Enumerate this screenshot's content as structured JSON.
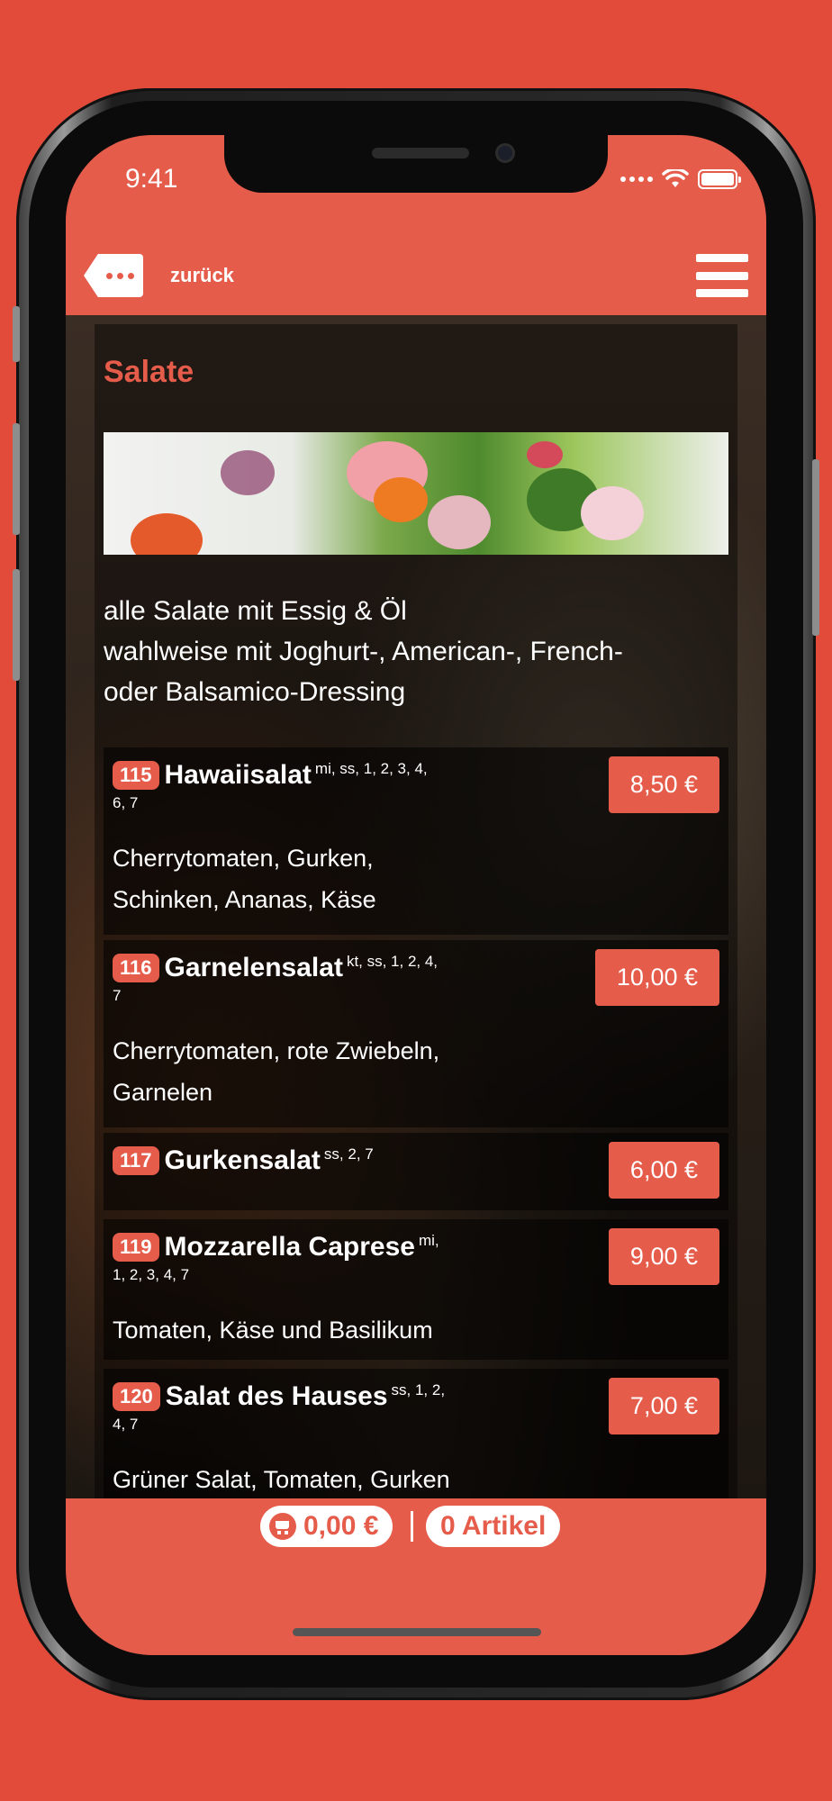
{
  "status": {
    "time": "9:41"
  },
  "header": {
    "back_label": "zurück"
  },
  "category": {
    "title": "Salate",
    "intro_line1": "alle Salate mit Essig & Öl",
    "intro_line2": "wahlweise mit Joghurt-, American-, French-",
    "intro_line3": "oder Balsamico-Dressing"
  },
  "items": [
    {
      "number": "115",
      "name": "Hawaiisalat",
      "allergens": "mi, ss, 1, 2, 3, 4,",
      "allergens_cont": "6, 7",
      "desc_line1": "Cherrytomaten, Gurken,",
      "desc_line2": "Schinken, Ananas, Käse",
      "price": "8,50 €"
    },
    {
      "number": "116",
      "name": "Garnelensalat",
      "allergens": "kt, ss, 1, 2, 4,",
      "allergens_cont": "7",
      "desc_line1": "Cherrytomaten, rote Zwiebeln,",
      "desc_line2": "Garnelen",
      "price": "10,00 €"
    },
    {
      "number": "117",
      "name": "Gurkensalat",
      "allergens": "ss, 2, 7",
      "price": "6,00 €"
    },
    {
      "number": "119",
      "name": "Mozzarella Caprese",
      "allergens": "mi,",
      "allergens_cont": "1, 2, 3, 4, 7",
      "desc_line1": "Tomaten, Käse und Basilikum",
      "price": "9,00 €"
    },
    {
      "number": "120",
      "name": "Salat des Hauses",
      "allergens": "ss, 1, 2,",
      "allergens_cont": "4, 7",
      "desc_line1": "Grüner Salat, Tomaten, Gurken",
      "price": "7,00 €"
    }
  ],
  "cart": {
    "total": "0,00 €",
    "count": "0 Artikel"
  },
  "colors": {
    "accent": "#e65c4b",
    "background": "#e24a3a"
  }
}
